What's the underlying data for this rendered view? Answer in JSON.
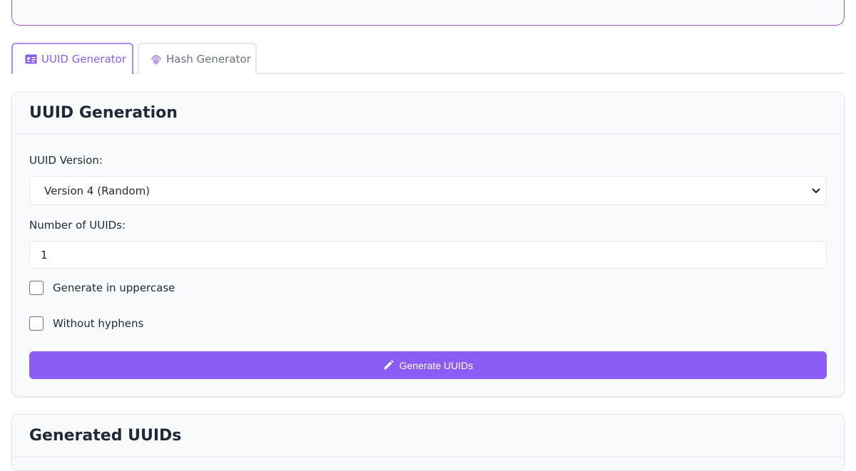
{
  "tabs": [
    {
      "label": "UUID Generator",
      "icon": "id-card-icon",
      "active": true
    },
    {
      "label": "Hash Generator",
      "icon": "fingerprint-icon",
      "active": false
    }
  ],
  "generation": {
    "title": "UUID Generation",
    "version_label": "UUID Version:",
    "version_value": "Version 4 (Random)",
    "count_label": "Number of UUIDs:",
    "count_value": "1",
    "uppercase_label": "Generate in uppercase",
    "uppercase_checked": false,
    "no_hyphens_label": "Without hyphens",
    "no_hyphens_checked": false,
    "button_label": "Generate UUIDs",
    "button_icon": "pencil-icon"
  },
  "output": {
    "title": "Generated UUIDs"
  },
  "colors": {
    "accent": "#8b5cf6",
    "tab_border_active": "#a78bfa",
    "header_border": "#a855c7"
  }
}
